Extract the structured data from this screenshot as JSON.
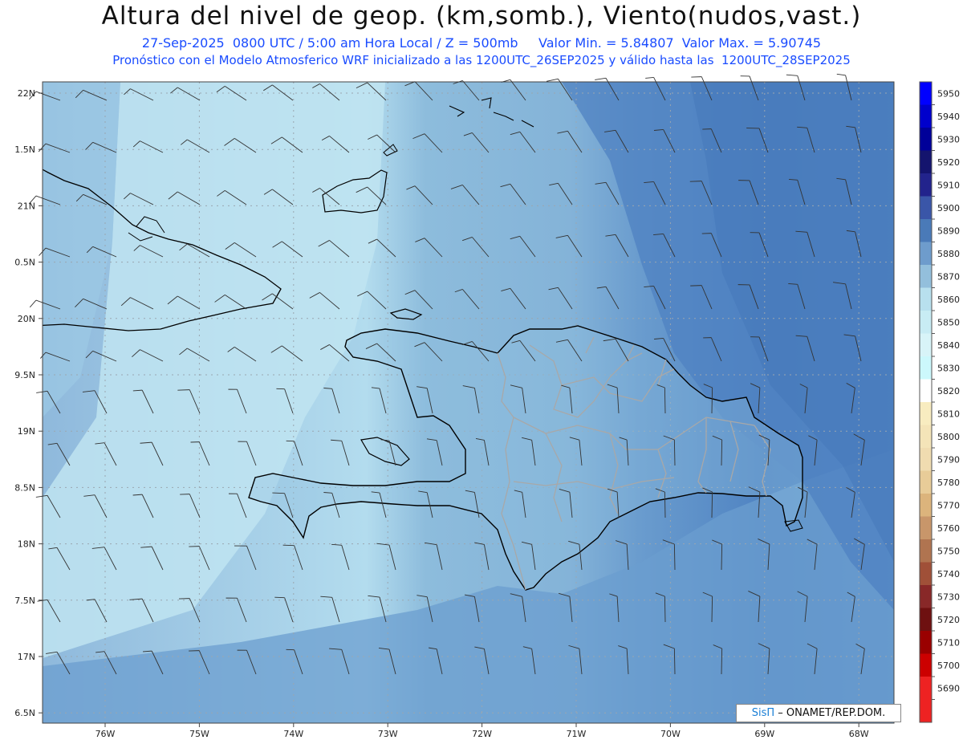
{
  "header": {
    "title": "Altura del nivel de geop. (km,somb.), Viento(nudos,vast.)",
    "subtitle_line1": "27-Sep-2025  0800 UTC / 5:00 am Hora Local / Z = 500mb     Valor Min. = 5.84807  Valor Max. = 5.90745",
    "subtitle_line2": "Pronóstico con el Modelo Atmosferico WRF inicializado a las 1200UTC_26SEP2025 y válido hasta las  1200UTC_28SEP2025"
  },
  "axes": {
    "lon_labels": [
      "76W",
      "75W",
      "74W",
      "73W",
      "72W",
      "71W",
      "70W",
      "69W",
      "68W"
    ],
    "lat_labels": [
      "22N",
      "1.5N",
      "21N",
      "0.5N",
      "20N",
      "9.5N",
      "19N",
      "8.5N",
      "18N",
      "7.5N",
      "17N",
      "6.5N"
    ]
  },
  "colorbar": {
    "labels": [
      "5950",
      "5940",
      "5930",
      "5920",
      "5910",
      "5900",
      "5890",
      "5880",
      "5870",
      "5860",
      "5850",
      "5840",
      "5830",
      "5820",
      "5810",
      "5800",
      "5790",
      "5780",
      "5770",
      "5760",
      "5750",
      "5740",
      "5730",
      "5720",
      "5710",
      "5700",
      "5690"
    ],
    "colors": [
      "#0000ff",
      "#0000cc",
      "#000099",
      "#14146e",
      "#22238c",
      "#3a56a8",
      "#4a7ab8",
      "#6e9ccc",
      "#93bfdc",
      "#b8e0ee",
      "#c8ecf4",
      "#d8f4f8",
      "#ccf8fc",
      "#ffffff",
      "#f8ecc0",
      "#f4e4b8",
      "#f0dcb0",
      "#e8cc98",
      "#dcb47c",
      "#c8966a",
      "#b07450",
      "#a05038",
      "#882828",
      "#6e1010",
      "#9a0000",
      "#cc0000",
      "#ee2222"
    ]
  },
  "credit": {
    "brand": "SisΠ",
    "text": "– ONAMET/REP.DOM."
  },
  "colors": {
    "ocean_west": "#8fbbdc",
    "ocean_east": "#5d8ec6",
    "light_band": "#b8e0ee",
    "mid_band": "#86b6da",
    "coast": "#000000",
    "provinces": "#a8a8a8",
    "grid": "#9aa8b4"
  }
}
